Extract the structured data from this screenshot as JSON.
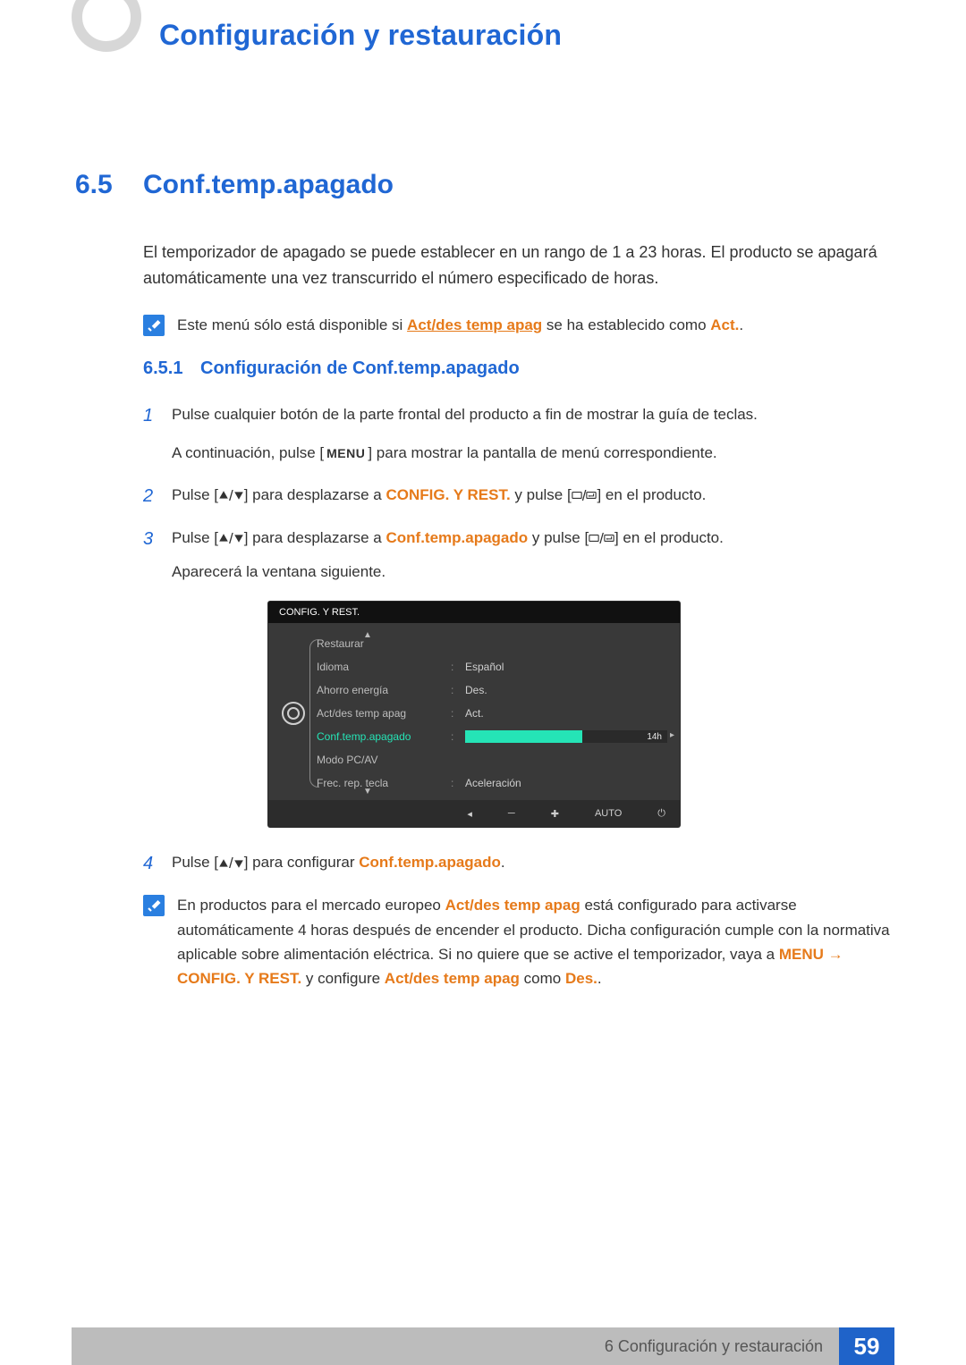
{
  "header": {
    "chapter_title": "Configuración y restauración"
  },
  "section": {
    "number": "6.5",
    "title": "Conf.temp.apagado",
    "intro": "El temporizador de apagado se puede establecer en un rango de 1 a 23 horas. El producto se apagará automáticamente una vez transcurrido el número especificado de horas."
  },
  "note1": {
    "prefix": "Este menú sólo está disponible si ",
    "accent1": "Act/des temp apag",
    "mid": " se ha establecido como ",
    "accent2": "Act.",
    "suffix": "."
  },
  "subsection": {
    "number": "6.5.1",
    "title": "Configuración de Conf.temp.apagado"
  },
  "steps": {
    "s1": {
      "n": "1",
      "line1": "Pulse cualquier botón de la parte frontal del producto a fin de mostrar la guía de teclas.",
      "line2_pre": "A continuación, pulse [",
      "line2_menu": "MENU",
      "line2_post": "] para mostrar la pantalla de menú correspondiente."
    },
    "s2": {
      "n": "2",
      "pre": "Pulse [",
      "mid1": "] para desplazarse a ",
      "accent": "CONFIG. Y REST.",
      "mid2": " y pulse [",
      "post": "] en el producto."
    },
    "s3": {
      "n": "3",
      "pre": "Pulse [",
      "mid1": "] para desplazarse a ",
      "accent": "Conf.temp.apagado",
      "mid2": " y pulse [",
      "post": "] en el producto.",
      "line2": "Aparecerá la ventana siguiente."
    },
    "s4": {
      "n": "4",
      "pre": "Pulse [",
      "mid": "] para configurar ",
      "accent": "Conf.temp.apagado",
      "post": "."
    }
  },
  "note2": {
    "t1": "En productos para el mercado europeo ",
    "a1": "Act/des temp apag",
    "t2": " está configurado para activarse automáticamente 4 horas después de encender el producto. Dicha configuración cumple con la normativa aplicable sobre alimentación eléctrica. Si no quiere que se active el temporizador, vaya a ",
    "a2": "MENU",
    "t3": "  →  ",
    "a3": "CONFIG. Y REST.",
    "t4": " y configure ",
    "a4": "Act/des temp apag",
    "t5": " como ",
    "a5": "Des.",
    "t6": "."
  },
  "osd": {
    "title": "CONFIG. Y REST.",
    "rows": {
      "r1": {
        "label": "Restaurar",
        "value": ""
      },
      "r2": {
        "label": "Idioma",
        "value": "Español"
      },
      "r3": {
        "label": "Ahorro energía",
        "value": "Des."
      },
      "r4": {
        "label": "Act/des temp apag",
        "value": "Act."
      },
      "r5": {
        "label": "Conf.temp.apagado",
        "value": "14h"
      },
      "r6": {
        "label": "Modo PC/AV",
        "value": ""
      },
      "r7": {
        "label": "Frec. rep. tecla",
        "value": "Aceleración"
      }
    },
    "foot_auto": "AUTO"
  },
  "footer": {
    "label": "6 Configuración y restauración",
    "page": "59"
  }
}
